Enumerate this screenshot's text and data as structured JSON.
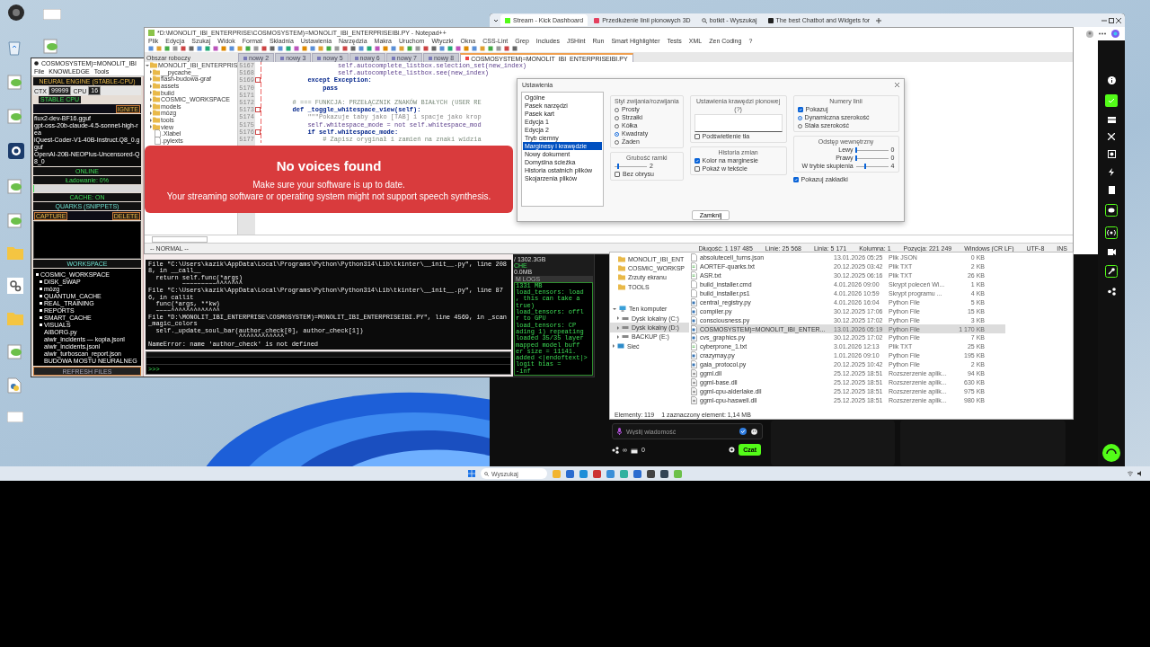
{
  "cosmic_app": {
    "title": "COSMOSYSTEM)=MONOLIT_IBI",
    "menu": [
      "File",
      "KNOWLEDGE",
      "Tools"
    ],
    "engine": {
      "heading": "NEURAL ENGINE (STABLE-CPU)",
      "ctx_label": "CTX",
      "ctx": "99999",
      "cpu_label": "CPU",
      "cpu": "16",
      "badge": "STABLE CPU",
      "ignite": "IGNITE",
      "models": [
        "flux2-dev-BF16.gguf",
        "gpt-oss-20b-claude-4.5-sonnet-high-rea",
        "iQuest-Coder-V1-40B-Instruct.Q8_0.gguf",
        "OpenAI-20B-NEOPlus-Uncensored-Q8_0"
      ],
      "status": "ONLINE",
      "loading": "Ładowanie: 0%",
      "progress": {
        "level": 0
      },
      "cache": "CACHE: ON"
    },
    "quarks": {
      "heading": "QUARKS (SNIPPETS)",
      "capture": "CAPTURE",
      "delete": "DELETE"
    },
    "workspace": {
      "heading": "WORKSPACE",
      "tree": [
        {
          "label": "COSMIC_WORKSPACE",
          "kind": "folder",
          "children": [
            {
              "label": "DISK_SWAP",
              "kind": "folder"
            },
            {
              "label": "mózg",
              "kind": "folder"
            },
            {
              "label": "QUANTUM_CACHE",
              "kind": "folder"
            },
            {
              "label": "REAL_TRAINING",
              "kind": "folder"
            },
            {
              "label": "REPORTS",
              "kind": "folder"
            },
            {
              "label": "SMART_CACHE",
              "kind": "folder"
            },
            {
              "label": "VISUALS",
              "kind": "folder"
            },
            {
              "label": "AIBORG.py",
              "kind": "file"
            },
            {
              "label": "aiwir_incidents — kopia.jsonl",
              "kind": "file"
            },
            {
              "label": "aiwir_incidents.jsonl",
              "kind": "file"
            },
            {
              "label": "aiwir_turboscan_report.json",
              "kind": "file"
            },
            {
              "label": "BUDOWA MOSTU NEURALNEG",
              "kind": "file"
            }
          ]
        }
      ],
      "refresh": "REFRESH FILES"
    },
    "traceback": [
      "File \"C:\\Users\\kazik\\AppData\\Local\\Programs\\Python\\Python314\\Lib\\tkinter\\__init__.py\", line 2088, in __call__",
      "  return self.func(*args)",
      "         ~~~~~~~~~^^^^^^^",
      "File \"C:\\Users\\kazik\\AppData\\Local\\Programs\\Python\\Python314\\Lib\\tkinter\\__init__.py\", line 876, in callit",
      "  func(*args, **kw)",
      "  ~~~~^^^^^^^^^^^^^",
      "File \"D:\\MONOLIT_IBI_ENTERPRISE\\COSMOSYSTEM)=MONOLIT_IBI_ENTERPRISEIBI.PY\", line 4569, in _scan_magic_colors",
      "  self._update_soul_bar(author_check[0], author_check[1])",
      "                        ^^^^^^^^^^^^"
    ],
    "error": "NameError: name 'author_check' is not defined",
    "prompt": ">>>",
    "logs": {
      "disk": "/ 1302.3GB",
      "cache": "CHE",
      "memory": "0.0MB",
      "heading": "M LOGS",
      "lines": [
        "1331 MB",
        "load_tensors: load",
        ", this can take a",
        "true)",
        "load_tensors: offl",
        "r to GPU",
        "load_tensors: CP",
        "ading 1) repeating",
        "loaded 35/35 layer",
        "mapped model buff",
        "er size = 11141.",
        "added <|endoftext|>",
        "logit bias =",
        "-inf"
      ]
    }
  },
  "notepad": {
    "title": "*D:\\MONOLIT_IBI_ENTERPRISE\\COSMOSYSTEM)=MONOLIT_IBI_ENTERPRISEIBI.PY - Notepad++",
    "menu": [
      "Plik",
      "Edycja",
      "Szukaj",
      "Widok",
      "Format",
      "Składnia",
      "Ustawienia",
      "Narzędzia",
      "Makra",
      "Uruchom",
      "Wtyczki",
      "Okna",
      "CSS-Lint",
      "Grep",
      "Includes",
      "JSHint",
      "Run",
      "Smart Highlighter",
      "Tests",
      "XML",
      "Zen Coding",
      "?"
    ],
    "panel_title": "Obszar roboczy",
    "tabs": [
      {
        "label": "nowy 2",
        "selected": false
      },
      {
        "label": "nowy 3",
        "selected": false
      },
      {
        "label": "nowy 5",
        "selected": false
      },
      {
        "label": "nowy 6",
        "selected": false
      },
      {
        "label": "nowy 7",
        "selected": false
      },
      {
        "label": "nowy 8",
        "selected": false
      },
      {
        "label": "COSMOSYSTEM)=MONOLIT_IBI_ENTERPRISEIBI.PY",
        "selected": true
      }
    ],
    "tree": [
      {
        "label": "MONOLIT_IBI_ENTERPRIS",
        "kind": "folder",
        "expanded": true,
        "children": [
          {
            "label": "__pycache__",
            "kind": "folder",
            "expanded": false
          },
          {
            "label": "flash-budowa-graf",
            "kind": "folder",
            "expanded": false
          },
          {
            "label": "assets",
            "kind": "folder",
            "expanded": false
          },
          {
            "label": "build",
            "kind": "folder",
            "expanded": false
          },
          {
            "label": "COSMIC_WORKSPACE",
            "kind": "folder",
            "expanded": false
          },
          {
            "label": "models",
            "kind": "folder",
            "expanded": false
          },
          {
            "label": "mózg",
            "kind": "folder",
            "expanded": false
          },
          {
            "label": "tools",
            "kind": "folder",
            "expanded": false
          },
          {
            "label": "view",
            "kind": "folder",
            "expanded": false
          },
          {
            "label": ".Xlabel",
            "kind": "file"
          },
          {
            "label": ".pylexts",
            "kind": "file"
          }
        ]
      }
    ],
    "code": [
      {
        "line": "5167",
        "text": "                    self.autocomplete_listbox.selection_set(new_index)",
        "kind": "plain",
        "fold": false
      },
      {
        "line": "5168",
        "text": "                    self.autocomplete_listbox.see(new_index)",
        "kind": "plain",
        "fold": false
      },
      {
        "line": "5169",
        "text": "            except Exception:",
        "kind": "keyword",
        "fold": true
      },
      {
        "line": "5170",
        "text": "                pass",
        "kind": "keyword",
        "fold": false
      },
      {
        "line": "5171",
        "fold": false
      },
      {
        "line": "5172",
        "text": "        # === FUNKCJA: PRZEŁĄCZNIK ZNAKÓW BIAŁYCH (USER RE",
        "kind": "comment",
        "fold": false
      },
      {
        "line": "5173",
        "text": "        def _toggle_whitespace_view(self):",
        "kind": "keyword",
        "fold": true
      },
      {
        "line": "5174",
        "text": "            \"\"\"Pokazuje taby jako [TAB] i spacje jako krop",
        "kind": "string",
        "fold": false
      },
      {
        "line": "5175",
        "text": "            self.whitespace_mode = not self.whitespace_mod",
        "kind": "plain",
        "fold": false
      },
      {
        "line": "5176",
        "text": "            if self.whitespace_mode:",
        "kind": "keyword",
        "fold": true
      },
      {
        "line": "5177",
        "text": "                # Zapisz oryginał i zamień na znaki widzia",
        "kind": "comment",
        "fold": false
      }
    ],
    "mode": "-- NORMAL --",
    "status": [
      "Długość: 1 197 485",
      "Linie: 25 568",
      "Linia: 5 171",
      "Kolumna: 1",
      "Pozycja: 221 249",
      "Windows (CR LF)",
      "UTF-8",
      "INS"
    ]
  },
  "browser": {
    "tabs": [
      {
        "label": "Stream - Kick Dashboard",
        "selected": true,
        "kind": "kick"
      },
      {
        "label": "Przedłużenie linii pionowych 3D",
        "selected": false,
        "kind": "video"
      },
      {
        "label": "botkit - Wyszukaj",
        "selected": false,
        "kind": "search"
      },
      {
        "label": "The best Chatbot and Widgets for",
        "selected": false,
        "kind": "bot"
      }
    ],
    "chat": {
      "placeholder": "Wyślij wiadomość",
      "viewers": "∞",
      "gifts": "0",
      "send": "Czat"
    }
  },
  "explorer": {
    "nav": [
      {
        "label": "MONOLIT_IBI_ENT",
        "kind": "folder",
        "selected": false
      },
      {
        "label": "COSMIC_WORKSP",
        "kind": "folder",
        "selected": false
      },
      {
        "label": "Zrzuty ekranu",
        "kind": "folder",
        "selected": false
      },
      {
        "label": "TOOLS",
        "kind": "folder",
        "selected": false
      },
      {
        "label": "Ten komputer",
        "kind": "pc",
        "selected": false,
        "expanded": true,
        "children": [
          {
            "label": "Dysk lokalny (C:)",
            "kind": "drive",
            "selected": false,
            "expanded": false
          },
          {
            "label": "Dysk lokalny (D:)",
            "kind": "drive",
            "selected": true,
            "expanded": false
          },
          {
            "label": "BACKUP (E:)",
            "kind": "drive",
            "selected": false,
            "expanded": false
          }
        ]
      },
      {
        "label": "Sieć",
        "kind": "network",
        "selected": false,
        "expanded": false
      }
    ],
    "files": [
      {
        "name": "absolutecell_turns.json",
        "date": "13.01.2026 05:25",
        "type": "Plik JSON",
        "size": "0 KB",
        "kind": "file",
        "selected": false
      },
      {
        "name": "AORTEF-quarks.txt",
        "date": "20.12.2025 03:42",
        "type": "Plik TXT",
        "size": "2 KB",
        "kind": "text",
        "selected": false
      },
      {
        "name": "ASR.txt",
        "date": "30.12.2025 06:16",
        "type": "Plik TXT",
        "size": "26 KB",
        "kind": "text",
        "selected": false
      },
      {
        "name": "build_installer.cmd",
        "date": "4.01.2026 09:00",
        "type": "Skrypt poleceń Wi...",
        "size": "1 KB",
        "kind": "file",
        "selected": false
      },
      {
        "name": "build_installer.ps1",
        "date": "4.01.2026 10:59",
        "type": "Skrypt programu ...",
        "size": "4 KB",
        "kind": "file",
        "selected": false
      },
      {
        "name": "central_registry.py",
        "date": "4.01.2026 16:04",
        "type": "Python File",
        "size": "5 KB",
        "kind": "python",
        "selected": false
      },
      {
        "name": "compiler.py",
        "date": "30.12.2025 17:06",
        "type": "Python File",
        "size": "15 KB",
        "kind": "python",
        "selected": false
      },
      {
        "name": "consciousness.py",
        "date": "30.12.2025 17:02",
        "type": "Python File",
        "size": "3 KB",
        "kind": "python",
        "selected": false
      },
      {
        "name": "COSMOSYSTEM)=MONOLIT_IBI_ENTER...",
        "date": "13.01.2026 05:19",
        "type": "Python File",
        "size": "1 170 KB",
        "kind": "python",
        "selected": true
      },
      {
        "name": "cvs_graphics.py",
        "date": "30.12.2025 17:02",
        "type": "Python File",
        "size": "7 KB",
        "kind": "python",
        "selected": false
      },
      {
        "name": "cyberprone_1.txt",
        "date": "3.01.2026 12:13",
        "type": "Plik TXT",
        "size": "25 KB",
        "kind": "text",
        "selected": false
      },
      {
        "name": "crazymay.py",
        "date": "1.01.2026 09:10",
        "type": "Python File",
        "size": "195 KB",
        "kind": "python",
        "selected": false
      },
      {
        "name": "gaia_protocol.py",
        "date": "20.12.2025 10:42",
        "type": "Python File",
        "size": "2 KB",
        "kind": "python",
        "selected": false
      },
      {
        "name": "ggml.dll",
        "date": "25.12.2025 18:51",
        "type": "Rozszerzenie aplik...",
        "size": "94 KB",
        "kind": "dll",
        "selected": false
      },
      {
        "name": "ggml-base.dll",
        "date": "25.12.2025 18:51",
        "type": "Rozszerzenie aplik...",
        "size": "630 KB",
        "kind": "dll",
        "selected": false
      },
      {
        "name": "ggml-cpu-alderlake.dll",
        "date": "25.12.2025 18:51",
        "type": "Rozszerzenie aplik...",
        "size": "975 KB",
        "kind": "dll",
        "selected": false
      },
      {
        "name": "ggml-cpu-haswell.dll",
        "date": "25.12.2025 18:51",
        "type": "Rozszerzenie aplik...",
        "size": "980 KB",
        "kind": "dll",
        "selected": false
      }
    ],
    "status": [
      "Elementy: 119",
      "1 zaznaczony element: 1,14 MB"
    ]
  },
  "settings": {
    "title": "Ustawienia",
    "categories": [
      {
        "label": "Ogólne",
        "selected": false
      },
      {
        "label": "Pasek narzędzi",
        "selected": false
      },
      {
        "label": "Pasek kart",
        "selected": false
      },
      {
        "label": "Edycja 1",
        "selected": false
      },
      {
        "label": "Edycja 2",
        "selected": false
      },
      {
        "label": "Tryb ciemny",
        "selected": false
      },
      {
        "label": "Marginesy i krawędzie",
        "selected": true
      },
      {
        "label": "Nowy dokument",
        "selected": false
      },
      {
        "label": "Domyślna ścieżka",
        "selected": false
      },
      {
        "label": "Historia ostatnich plików",
        "selected": false
      },
      {
        "label": "Skojarzenia plików",
        "selected": false
      }
    ],
    "folding": {
      "title": "Styl zwijania/rozwijania",
      "options": [
        {
          "label": "Prosty",
          "selected": false
        },
        {
          "label": "Strzałki",
          "selected": false
        },
        {
          "label": "Kółka",
          "selected": false
        },
        {
          "label": "Kwadraty",
          "selected": true
        },
        {
          "label": "Żaden",
          "selected": false
        }
      ]
    },
    "border": {
      "title": "Grubość ramki",
      "level": 0.1,
      "value": "2",
      "no_edge": {
        "label": "Bez obrysu",
        "checked": false
      }
    },
    "edge": {
      "title": "Ustawienia krawędzi pionowej",
      "hint": "(?)",
      "background": {
        "label": "Podświetlenie tła",
        "checked": false
      }
    },
    "history": {
      "title": "Historia zmian",
      "options": [
        {
          "label": "Kolor na marginesie",
          "checked": true
        },
        {
          "label": "Pokaż w tekście",
          "checked": false
        }
      ]
    },
    "line_numbers": {
      "title": "Numery linii",
      "show": {
        "label": "Pokazuj",
        "checked": true
      },
      "widths": [
        {
          "label": "Dynamiczna szerokość",
          "selected": true
        },
        {
          "label": "Stała szerokość",
          "selected": false
        }
      ]
    },
    "padding": {
      "title": "Odstęp wewnętrzny",
      "sliders": [
        {
          "label": "Lewy",
          "level": 0,
          "value": "0"
        },
        {
          "label": "Prawy",
          "level": 0,
          "value": "0"
        },
        {
          "label": "W trybie skupienia",
          "level": 0.3,
          "value": "4"
        }
      ]
    },
    "bookmarks": {
      "label": "Pokazuj zakładki",
      "checked": true
    },
    "close": "Zamknij"
  },
  "toast": {
    "title": "No voices found",
    "lines": [
      "Make sure your software is up to date.",
      "Your streaming software or operating system might not support speech synthesis."
    ]
  },
  "taskbar": {
    "search": "Wyszukaj"
  }
}
